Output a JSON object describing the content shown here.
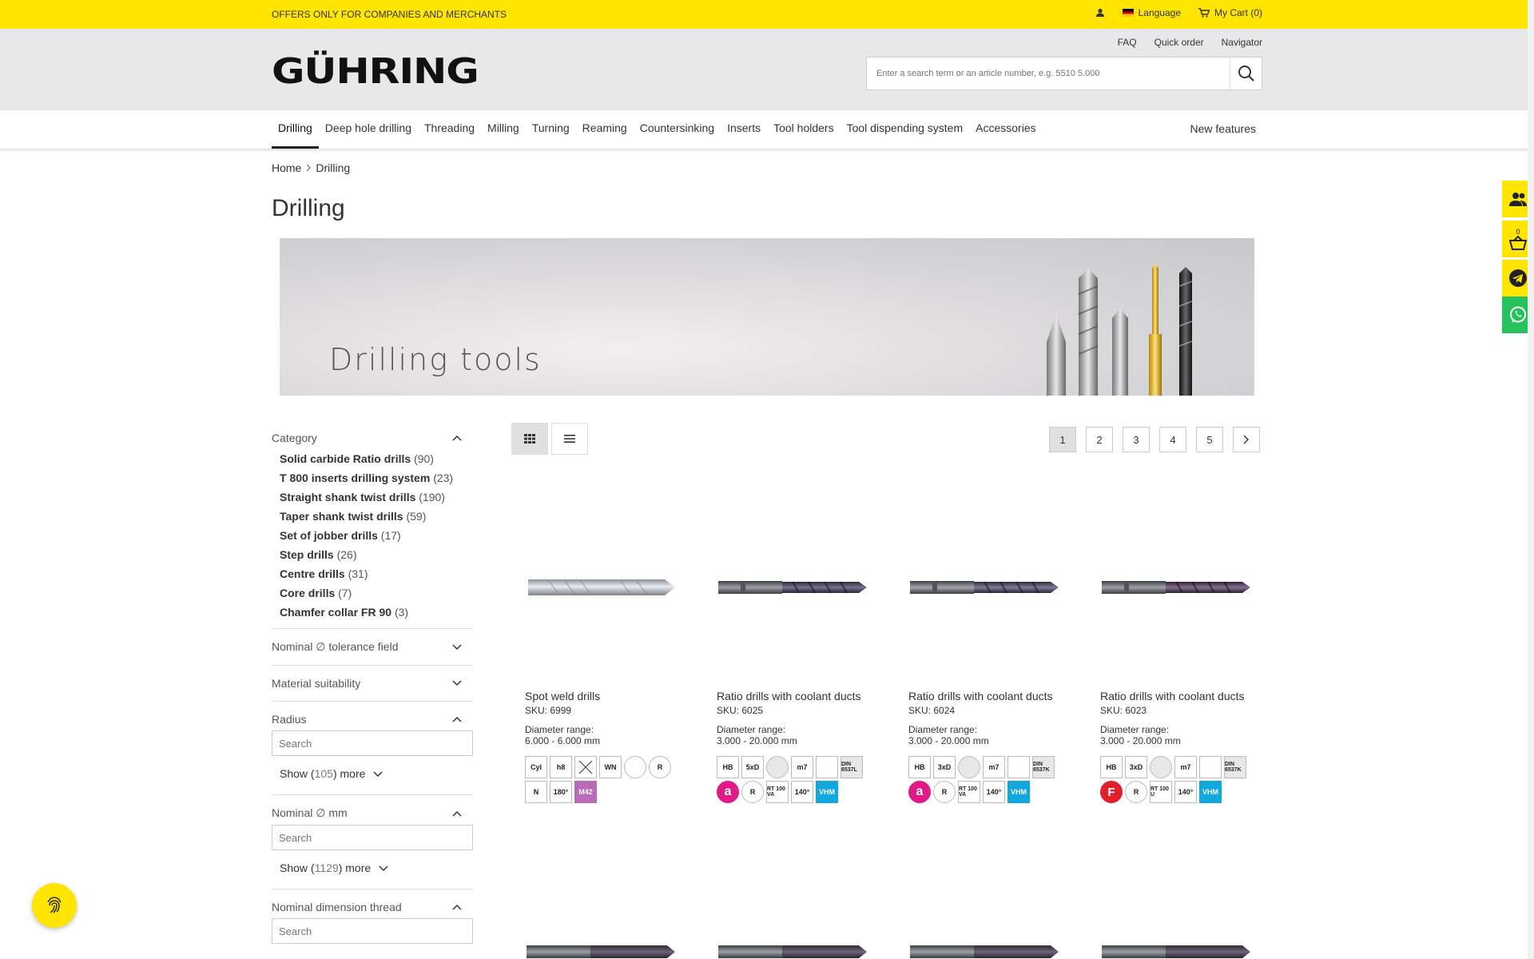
{
  "topbar": {
    "offer": "OFFERS ONLY FOR COMPANIES AND MERCHANTS",
    "language": "Language",
    "cart": "My Cart (0)"
  },
  "header": {
    "links": [
      "FAQ",
      "Quick order",
      "Navigator"
    ],
    "logo": "GÜHRING",
    "search_placeholder": "Enter a search term or an article number, e.g. 5510 5.000"
  },
  "nav": {
    "items": [
      "Drilling",
      "Deep hole drilling",
      "Threading",
      "Milling",
      "Turning",
      "Reaming",
      "Countersinking",
      "Inserts",
      "Tool holders",
      "Tool dispending system",
      "Accessories"
    ],
    "active": "Drilling",
    "new_features": "New features"
  },
  "breadcrumb": {
    "home": "Home",
    "current": "Drilling"
  },
  "page_title": "Drilling",
  "banner": {
    "text": "Drilling tools"
  },
  "filters": {
    "category": {
      "label": "Category",
      "items": [
        {
          "name": "Solid carbide Ratio drills",
          "count": "(90)"
        },
        {
          "name": "T 800 inserts drilling system",
          "count": "(23)"
        },
        {
          "name": "Straight shank twist drills",
          "count": "(190)"
        },
        {
          "name": "Taper shank twist drills",
          "count": "(59)"
        },
        {
          "name": "Set of jobber drills",
          "count": "(17)"
        },
        {
          "name": "Step drills",
          "count": "(26)"
        },
        {
          "name": "Centre drills",
          "count": "(31)"
        },
        {
          "name": "Core drills",
          "count": "(7)"
        },
        {
          "name": "Chamfer collar FR 90",
          "count": "(3)"
        }
      ]
    },
    "tolerance": "Nominal ∅ tolerance field",
    "material": "Material suitability",
    "radius": {
      "label": "Radius",
      "placeholder": "Search",
      "show_pre": "Show (",
      "show_n": "105",
      "show_post": ") more"
    },
    "nominal": {
      "label": "Nominal ∅ mm",
      "placeholder": "Search",
      "show_pre": "Show (",
      "show_n": "1129",
      "show_post": ") more"
    },
    "thread": {
      "label": "Nominal dimension thread",
      "placeholder": "Search"
    }
  },
  "pagination": [
    "1",
    "2",
    "3",
    "4",
    "5"
  ],
  "products": [
    {
      "name": "Spot weld drills",
      "sku": "SKU: 6999",
      "dlabel": "Diameter range:",
      "drange": "6.000 - 6.000 mm",
      "badges": [
        "Cyl",
        "h8",
        "",
        "WN",
        "",
        "R",
        "N",
        "180°",
        "M42"
      ]
    },
    {
      "name": "Ratio drills with coolant ducts",
      "sku": "SKU: 6025",
      "dlabel": "Diameter range:",
      "drange": "3.000 - 20.000 mm",
      "badges": [
        "HB",
        "5xD",
        "",
        "m7",
        "",
        "DIN 6537L",
        "a",
        "R",
        "RT 100 VA",
        "140°",
        "VHM"
      ]
    },
    {
      "name": "Ratio drills with coolant ducts",
      "sku": "SKU: 6024",
      "dlabel": "Diameter range:",
      "drange": "3.000 - 20.000 mm",
      "badges": [
        "HB",
        "3xD",
        "",
        "m7",
        "",
        "DIN 6537K",
        "a",
        "R",
        "RT 100 VA",
        "140°",
        "VHM"
      ]
    },
    {
      "name": "Ratio drills with coolant ducts",
      "sku": "SKU: 6023",
      "dlabel": "Diameter range:",
      "drange": "3.000 - 20.000 mm",
      "badges": [
        "HB",
        "3xD",
        "",
        "m7",
        "",
        "DIN 6537K",
        "F",
        "R",
        "RT 100 U",
        "140°",
        "VHM"
      ]
    }
  ],
  "floating": {
    "cart_count": "0"
  }
}
